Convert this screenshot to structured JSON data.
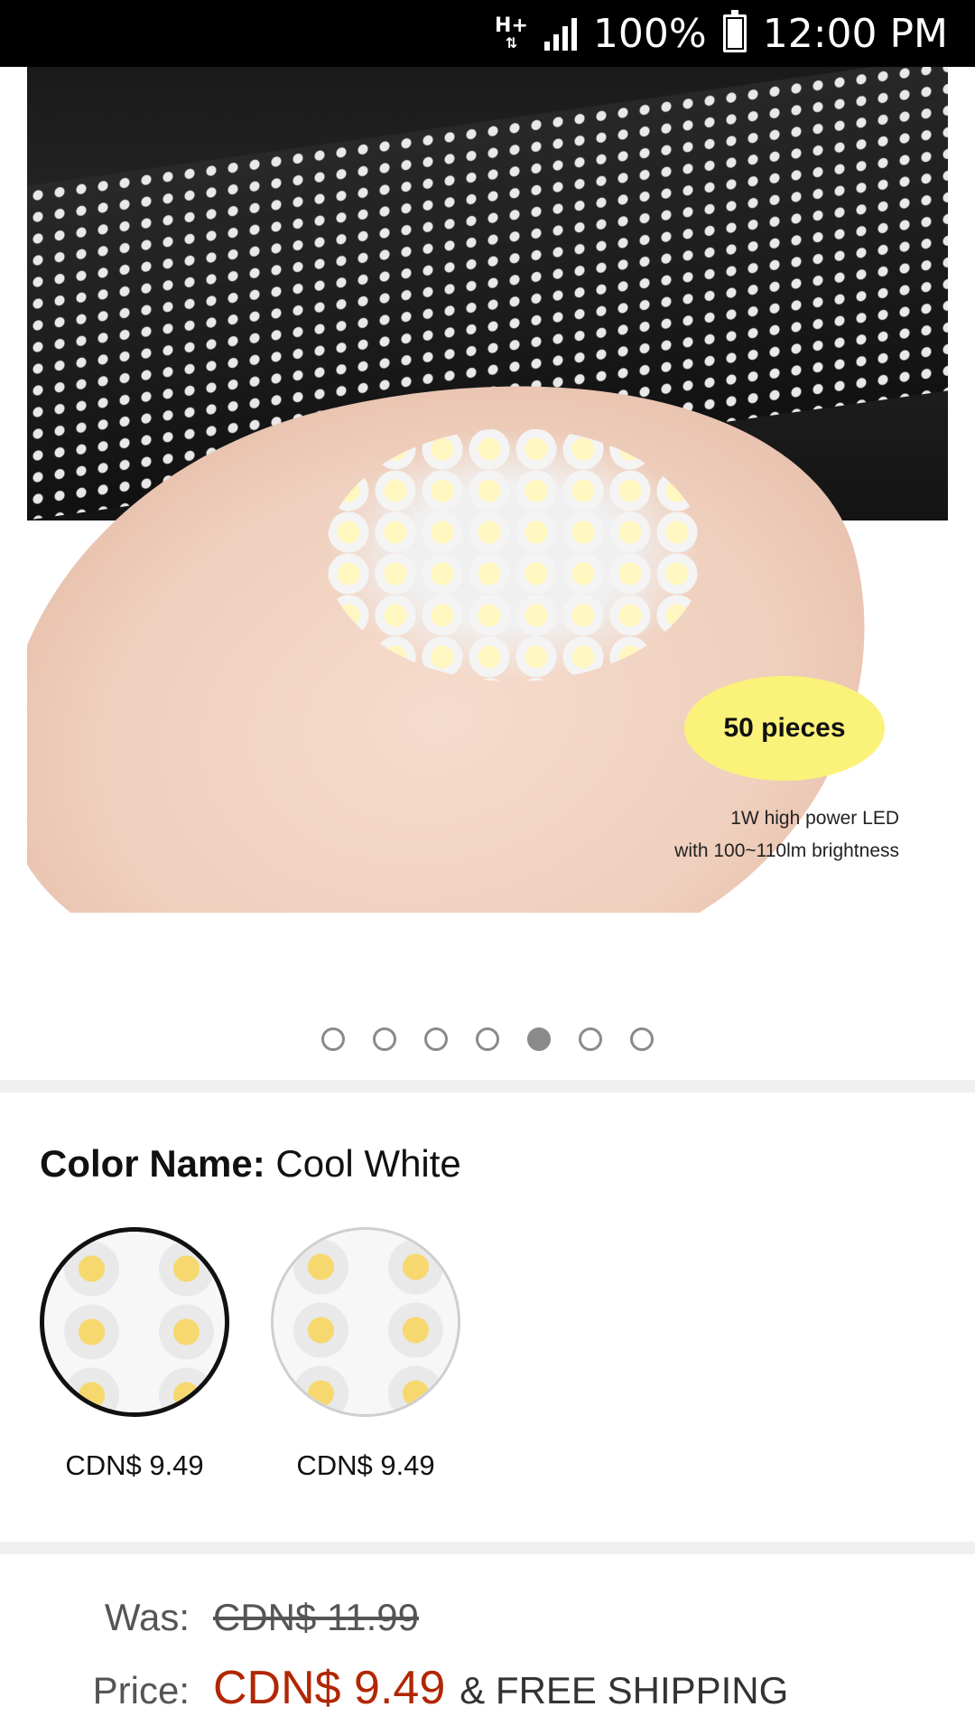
{
  "status_bar": {
    "network": "H+",
    "battery_percent": "100%",
    "time": "12:00 PM"
  },
  "product_image": {
    "badge_text": "50 pieces",
    "caption_line1": "1W high power LED",
    "caption_line2": "with 100~110lm brightness",
    "carousel": {
      "total": 7,
      "active_index": 4
    }
  },
  "variation": {
    "label": "Color Name:",
    "selected_value": "Cool White",
    "options": [
      {
        "price": "CDN$ 9.49",
        "selected": true
      },
      {
        "price": "CDN$ 9.49",
        "selected": false
      }
    ]
  },
  "pricing": {
    "was_label": "Was:",
    "was_value": "CDN$ 11.99",
    "price_label": "Price:",
    "price_value": "CDN$ 9.49",
    "shipping": "& FREE SHIPPING",
    "price_color": "#b12704"
  }
}
